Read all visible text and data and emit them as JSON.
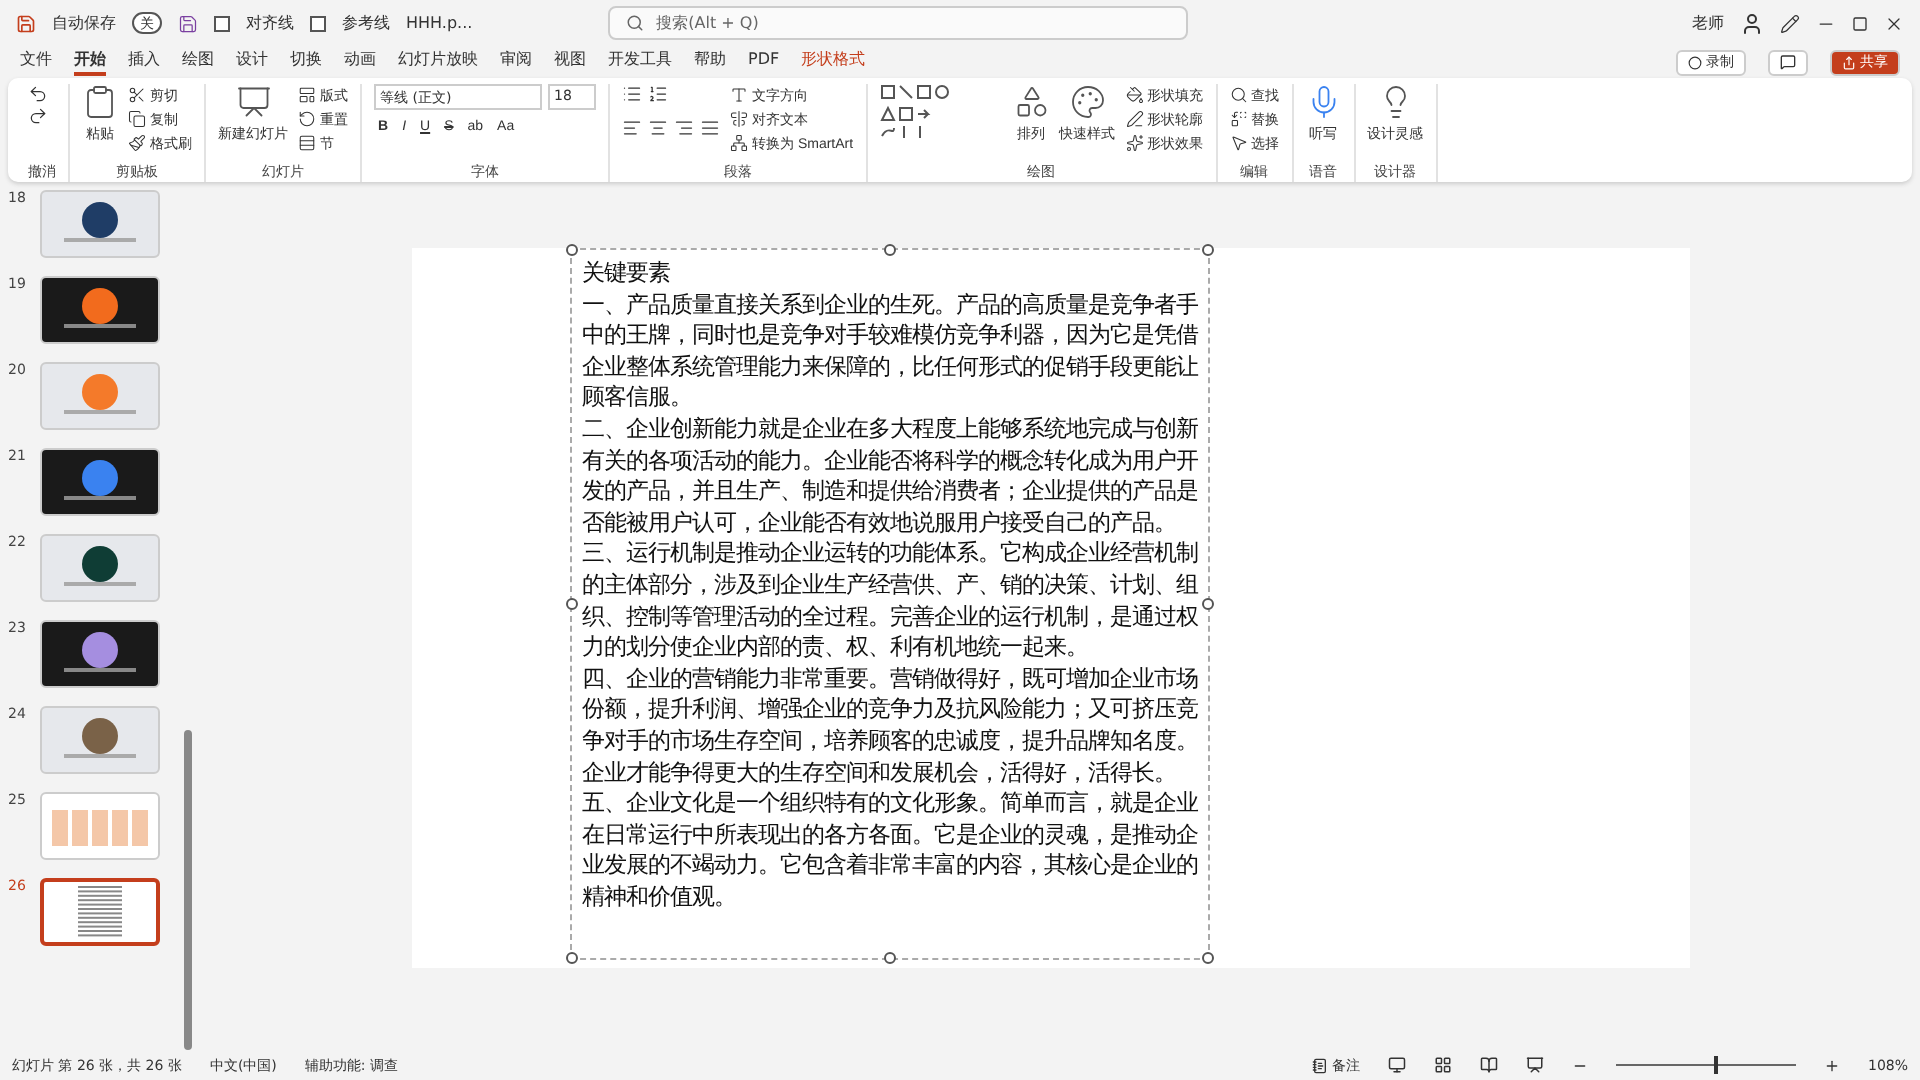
{
  "title_bar": {
    "autosave_label": "自动保存",
    "autosave_state": "关",
    "autosave_on": false,
    "quick_checks": [
      {
        "label": "对齐线",
        "checked": false
      },
      {
        "label": "参考线",
        "checked": false
      }
    ],
    "file_name": "HHH.p...",
    "search": {
      "placeholder": "搜索(Alt + Q)"
    },
    "user": "老师"
  },
  "menu_tabs": [
    {
      "label": "文件",
      "selected": false,
      "kind": "normal"
    },
    {
      "label": "开始",
      "selected": true,
      "kind": "normal"
    },
    {
      "label": "插入",
      "selected": false,
      "kind": "normal"
    },
    {
      "label": "绘图",
      "selected": false,
      "kind": "normal"
    },
    {
      "label": "设计",
      "selected": false,
      "kind": "normal"
    },
    {
      "label": "切换",
      "selected": false,
      "kind": "normal"
    },
    {
      "label": "动画",
      "selected": false,
      "kind": "normal"
    },
    {
      "label": "幻灯片放映",
      "selected": false,
      "kind": "normal"
    },
    {
      "label": "审阅",
      "selected": false,
      "kind": "normal"
    },
    {
      "label": "视图",
      "selected": false,
      "kind": "normal"
    },
    {
      "label": "开发工具",
      "selected": false,
      "kind": "normal"
    },
    {
      "label": "帮助",
      "selected": false,
      "kind": "normal"
    },
    {
      "label": "PDF",
      "selected": false,
      "kind": "normal"
    },
    {
      "label": "形状格式",
      "selected": false,
      "kind": "context"
    }
  ],
  "header_buttons": {
    "record": "录制",
    "share": "共享"
  },
  "ribbon": [
    {
      "label": "撤消"
    },
    {
      "label": "剪贴板",
      "items": [
        {
          "label": "粘贴",
          "kind": "large"
        },
        {
          "label": "剪切",
          "kind": "small"
        },
        {
          "label": "复制",
          "kind": "small"
        },
        {
          "label": "格式刷",
          "kind": "small"
        }
      ]
    },
    {
      "label": "幻灯片",
      "items": [
        {
          "label": "新建幻灯片",
          "kind": "large"
        },
        {
          "label": "版式",
          "kind": "small"
        },
        {
          "label": "重置",
          "kind": "small"
        },
        {
          "label": "节",
          "kind": "small"
        }
      ]
    },
    {
      "label": "字体"
    },
    {
      "label": "段落",
      "items": [
        {
          "label": "文字方向",
          "kind": "small"
        },
        {
          "label": "对齐文本",
          "kind": "small"
        },
        {
          "label": "转换为 SmartArt",
          "kind": "small"
        }
      ]
    },
    {
      "label": "绘图",
      "items": [
        {
          "label": "排列",
          "kind": "large"
        },
        {
          "label": "快速样式",
          "kind": "large"
        },
        {
          "label": "形状填充",
          "kind": "small"
        },
        {
          "label": "形状轮廓",
          "kind": "small"
        },
        {
          "label": "形状效果",
          "kind": "small"
        }
      ]
    },
    {
      "label": "编辑",
      "items": [
        {
          "label": "查找",
          "kind": "small"
        },
        {
          "label": "替换",
          "kind": "small"
        },
        {
          "label": "选择",
          "kind": "small"
        }
      ]
    },
    {
      "label": "语音",
      "items": [
        {
          "label": "听写",
          "kind": "large"
        }
      ]
    },
    {
      "label": "设计器",
      "items": [
        {
          "label": "设计灵感",
          "kind": "large"
        }
      ]
    }
  ],
  "font": {
    "name": "等线 (正文)",
    "size": "18",
    "buttons": [
      "B",
      "I",
      "U",
      "S",
      "ab",
      "Aa"
    ]
  },
  "thumbnails": [
    {
      "number": "18",
      "kind": "light",
      "color": "#1f3d66",
      "selected": false
    },
    {
      "number": "19",
      "kind": "dark",
      "color": "#f26b1d",
      "selected": false
    },
    {
      "number": "20",
      "kind": "light",
      "color": "#f47a2a",
      "selected": false
    },
    {
      "number": "21",
      "kind": "dark",
      "color": "#3a82f0",
      "selected": false
    },
    {
      "number": "22",
      "kind": "light",
      "color": "#0f3d35",
      "selected": false
    },
    {
      "number": "23",
      "kind": "dark",
      "color": "#a58ee0",
      "selected": false
    },
    {
      "number": "24",
      "kind": "light",
      "color": "#7a6248",
      "selected": false
    },
    {
      "number": "25",
      "kind": "table",
      "color": "#f4c7a8",
      "selected": false
    },
    {
      "number": "26",
      "kind": "text",
      "color": "#ffffff",
      "selected": true
    }
  ],
  "slide": {
    "paragraphs": [
      "关键要素",
      "一、产品质量直接关系到企业的生死。产品的高质量是竞争者手中的王牌，同时也是竞争对手较难模仿竞争利器，因为它是凭借企业整体系统管理能力来保障的，比任何形式的促销手段更能让顾客信服。",
      "二、企业创新能力就是企业在多大程度上能够系统地完成与创新有关的各项活动的能力。企业能否将科学的概念转化成为用户开发的产品，并且生产、制造和提供给消费者；企业提供的产品是否能被用户认可，企业能否有效地说服用户接受自己的产品。",
      "三、运行机制是推动企业运转的功能体系。它构成企业经营机制的主体部分，涉及到企业生产经营供、产、销的决策、计划、组织、控制等管理活动的全过程。完善企业的运行机制，是通过权力的划分使企业内部的责、权、利有机地统一起来。",
      "四、企业的营销能力非常重要。营销做得好，既可增加企业市场份额，提升利润、增强企业的竞争力及抗风险能力；又可挤压竞争对手的市场生存空间，培养顾客的忠诚度，提升品牌知名度。企业才能争得更大的生存空间和发展机会，活得好，活得长。",
      "五、企业文化是一个组织特有的文化形象。简单而言，就是企业在日常运行中所表现出的各方各面。它是企业的灵魂，是推动企业发展的不竭动力。它包含着非常丰富的内容，其核心是企业的精神和价值观。"
    ]
  },
  "status_bar": {
    "slide_info": "幻灯片 第 26 张，共 26 张",
    "language": "中文(中国)",
    "accessibility": "辅助功能: 调查",
    "notes": "备注",
    "zoom": "108%",
    "level": 0.55
  }
}
